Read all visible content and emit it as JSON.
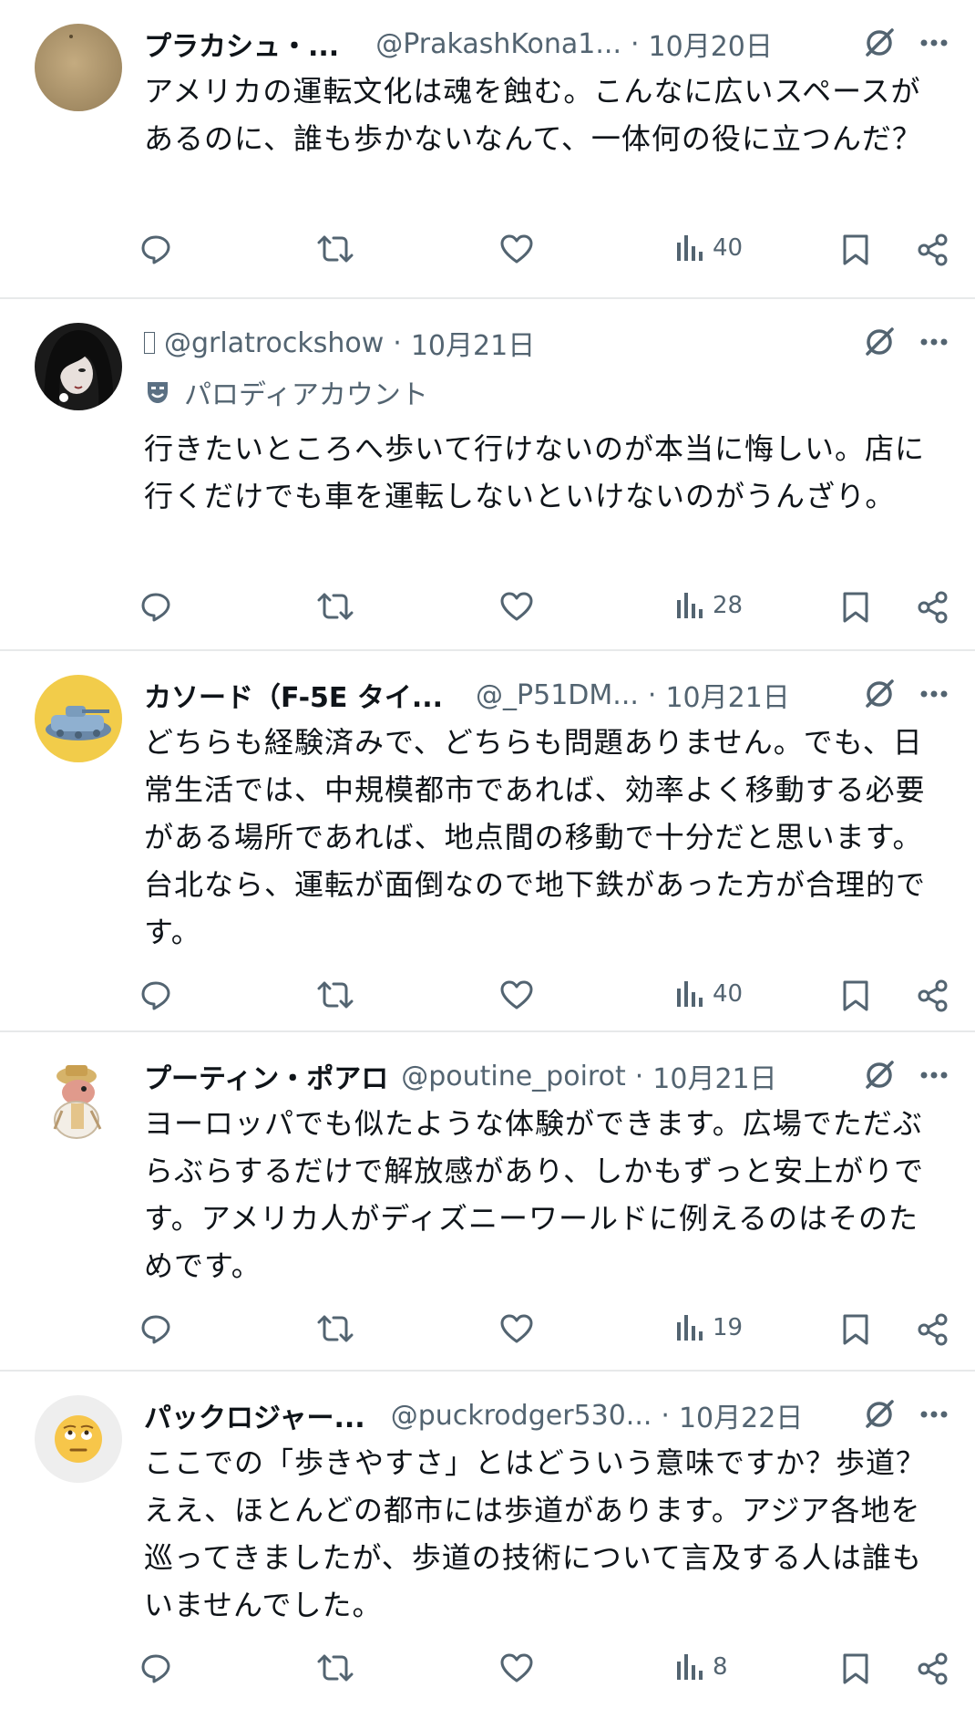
{
  "colors": {
    "text": "#0f1419",
    "secondary": "#536471",
    "divider": "#e7e9ea"
  },
  "tweets": [
    {
      "name": "プラカシュ・...",
      "handle": "@PrakashKona1...",
      "dot": "·",
      "date": "10月20日",
      "avatar": "beige-avatar",
      "body": "アメリカの運転文化は魂を蝕む。こんなに広いスペースがあるのに、誰も歩かないなんて、一体何の役に立つんだ？",
      "views": "40"
    },
    {
      "name": "",
      "handle": "@grlatrockshow",
      "dot": "·",
      "date": "10月21日",
      "avatar": "dark-hair-avatar",
      "parody_label": "パロディアカウント",
      "body": "行きたいところへ歩いて行けないのが本当に悔しい。店に行くだけでも車を運転しないといけないのがうんざり。",
      "views": "28"
    },
    {
      "name": "カソード（F-5E タイ...",
      "handle": "@_P51DM...",
      "dot": "·",
      "date": "10月21日",
      "avatar": "yellow-tank-avatar",
      "body": "どちらも経験済みで、どちらも問題ありません。でも、日常生活では、中規模都市であれば、効率よく移動する必要がある場所であれば、地点間の移動で十分だと思います。台北なら、運転が面倒なので地下鉄があった方が合理的です。",
      "views": "40"
    },
    {
      "name": "プーティン・ポアロ",
      "handle": "@poutine_poirot",
      "dot": "·",
      "date": "10月21日",
      "avatar": "detective-avatar",
      "body": "ヨーロッパでも似たような体験ができます。広場でただぶらぶらするだけで解放感があり、しかもずっと安上がりです。アメリカ人がディズニーワールドに例えるのはそのためです。",
      "views": "19"
    },
    {
      "name": "パックロジャー...",
      "handle": "@puckrodger530...",
      "dot": "·",
      "date": "10月22日",
      "avatar": "eye-roll-emoji-avatar",
      "body": "ここでの「歩きやすさ」とはどういう意味ですか？歩道？ええ、ほとんどの都市には歩道があります。アジア各地を巡ってきましたが、歩道の技術について言及する人は誰もいませんでした。",
      "views": "8"
    }
  ]
}
